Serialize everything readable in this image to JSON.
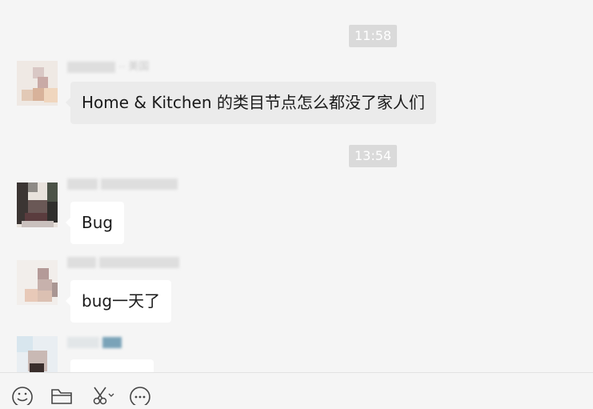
{
  "chat": {
    "messages": [
      {
        "time": "11:58"
      },
      {
        "sender": "·· 美国",
        "text": "Home & Kitchen 的类目节点怎么都没了家人们"
      },
      {
        "time": "13:54"
      },
      {
        "sender": "",
        "text": "Bug"
      },
      {
        "sender": "",
        "text": "bug一天了"
      },
      {
        "sender": "",
        "text": ""
      }
    ]
  },
  "toolbar": {
    "icons": [
      "emoji-icon",
      "folder-icon",
      "scissors-icon",
      "chat-history-icon"
    ]
  },
  "colors": {
    "background": "#f5f5f5",
    "bubble_white": "#ffffff",
    "bubble_gray": "#ebebeb",
    "time_badge": "#dadada"
  }
}
